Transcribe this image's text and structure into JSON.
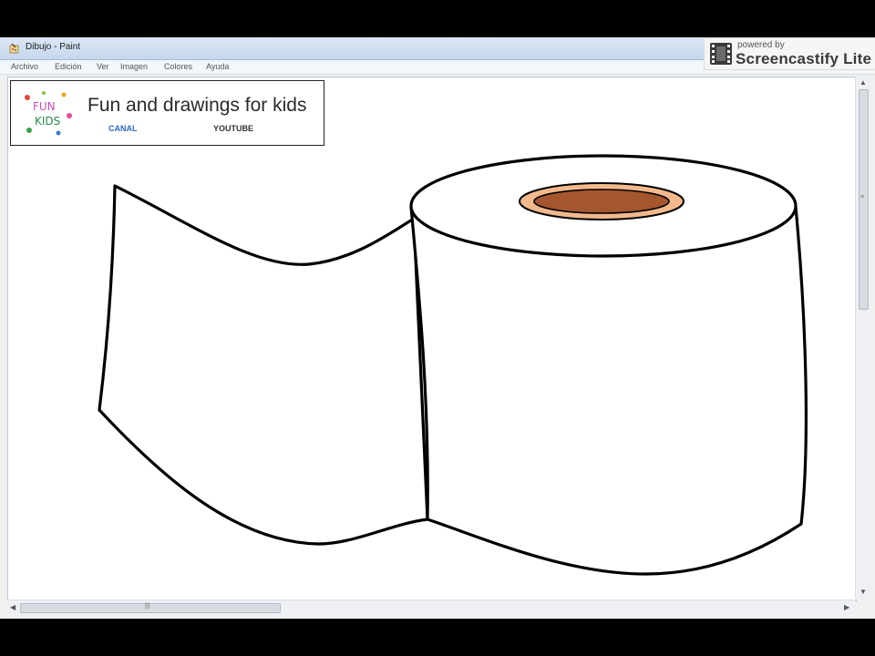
{
  "window": {
    "title": "Dibujo - Paint"
  },
  "menu": {
    "items": [
      {
        "label": "Archivo"
      },
      {
        "label": "Edición"
      },
      {
        "label": "Ver"
      },
      {
        "label": "Imagen"
      },
      {
        "label": "Colores"
      },
      {
        "label": "Ayuda"
      }
    ]
  },
  "watermark": {
    "small": "powered by",
    "big": "Screencastify Lite"
  },
  "banner": {
    "title": "Fun and drawings for kids",
    "link1": "CANAL",
    "link2": "YOUTUBE",
    "logo_text_top": "FUN",
    "logo_text_bottom": "KIDS"
  },
  "colors": {
    "core_outer": "#f2b98c",
    "core_inner": "#a4572f",
    "link1": "#2a6ac8",
    "link2": "#333333",
    "outline": "#000000"
  },
  "icons": {
    "app": "paint-app-icon",
    "watermark": "film-strip-icon",
    "scroll_up": "arrow-up-icon",
    "scroll_down": "arrow-down-icon",
    "scroll_left": "arrow-left-icon",
    "scroll_right": "arrow-right-icon"
  },
  "scrollbars": {
    "up": "▲",
    "down": "▼",
    "left": "◀",
    "right": "▶",
    "grip_v": "≡",
    "grip_h": "|||"
  }
}
